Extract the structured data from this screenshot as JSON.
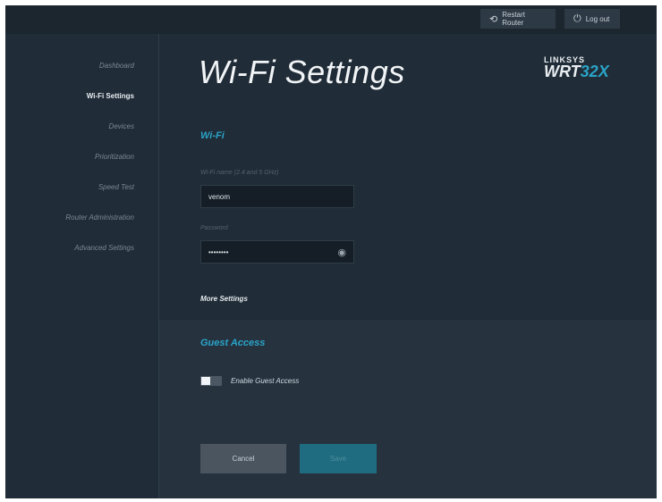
{
  "header": {
    "restart_label": "Restart Router",
    "logout_label": "Log out"
  },
  "sidebar": {
    "items": [
      {
        "label": "Dashboard",
        "active": false
      },
      {
        "label": "Wi-Fi Settings",
        "active": true
      },
      {
        "label": "Devices",
        "active": false
      },
      {
        "label": "Prioritization",
        "active": false
      },
      {
        "label": "Speed Test",
        "active": false
      },
      {
        "label": "Router Administration",
        "active": false
      },
      {
        "label": "Advanced Settings",
        "active": false
      }
    ]
  },
  "page": {
    "title": "Wi-Fi Settings"
  },
  "logo": {
    "brand": "LINKSYS",
    "model_prefix": "WRT",
    "model_suffix": "32X"
  },
  "wifi": {
    "section_title": "Wi-Fi",
    "name_label": "Wi-Fi name (2.4 and 5 GHz)",
    "name_value": "venom",
    "password_label": "Password",
    "password_value": "••••••••",
    "more_settings_label": "More Settings"
  },
  "guest": {
    "section_title": "Guest Access",
    "toggle_label": "Enable Guest Access",
    "enabled": false
  },
  "actions": {
    "cancel_label": "Cancel",
    "save_label": "Save"
  },
  "colors": {
    "background": "#202c37",
    "accent": "#2aa3c7",
    "save_button": "#1f6b7f",
    "cancel_button": "#4a5560"
  },
  "icons": {
    "restart": "power-cycle-icon",
    "logout": "power-icon",
    "password_visibility": "eye-icon"
  }
}
